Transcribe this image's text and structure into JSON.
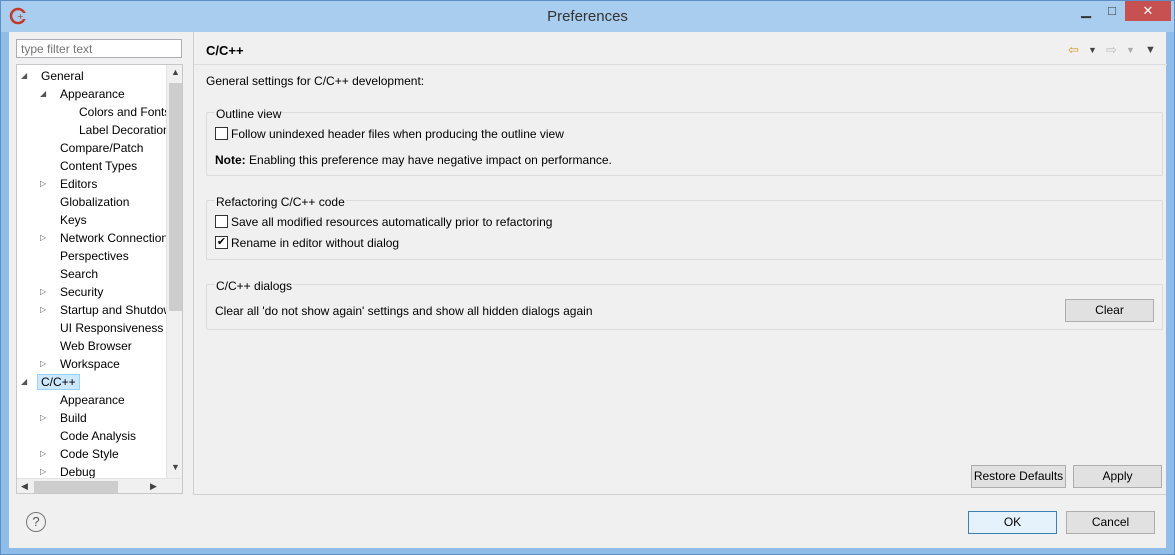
{
  "window": {
    "title": "Preferences"
  },
  "filter": {
    "placeholder": "type filter text"
  },
  "tree": {
    "items": [
      {
        "label": "General",
        "toggle": "◢"
      },
      {
        "label": "Appearance",
        "toggle": "◢"
      },
      {
        "label": "Colors and Fonts",
        "toggle": ""
      },
      {
        "label": "Label Decorations",
        "toggle": ""
      },
      {
        "label": "Compare/Patch",
        "toggle": ""
      },
      {
        "label": "Content Types",
        "toggle": ""
      },
      {
        "label": "Editors",
        "toggle": "▷"
      },
      {
        "label": "Globalization",
        "toggle": ""
      },
      {
        "label": "Keys",
        "toggle": ""
      },
      {
        "label": "Network Connections",
        "toggle": "▷"
      },
      {
        "label": "Perspectives",
        "toggle": ""
      },
      {
        "label": "Search",
        "toggle": ""
      },
      {
        "label": "Security",
        "toggle": "▷"
      },
      {
        "label": "Startup and Shutdown",
        "toggle": "▷"
      },
      {
        "label": "UI Responsiveness Monitoring",
        "toggle": ""
      },
      {
        "label": "Web Browser",
        "toggle": ""
      },
      {
        "label": "Workspace",
        "toggle": "▷"
      },
      {
        "label": "C/C++",
        "toggle": "◢"
      },
      {
        "label": "Appearance",
        "toggle": ""
      },
      {
        "label": "Build",
        "toggle": "▷"
      },
      {
        "label": "Code Analysis",
        "toggle": ""
      },
      {
        "label": "Code Style",
        "toggle": "▷"
      },
      {
        "label": "Debug",
        "toggle": "▷"
      }
    ]
  },
  "panel": {
    "title": "C/C++",
    "description": "General settings for C/C++ development:",
    "outline": {
      "label": "Outline view",
      "checkbox_label": "Follow unindexed header files when producing the outline view",
      "checked": false,
      "note_bold": "Note:",
      "note_text": "Enabling this preference may have negative impact on performance."
    },
    "refactoring": {
      "label": "Refactoring C/C++ code",
      "save_label": "Save all modified resources automatically prior to refactoring",
      "save_checked": false,
      "rename_label": "Rename in editor without dialog",
      "rename_checked": true
    },
    "dialogs": {
      "label": "C/C++ dialogs",
      "text": "Clear all 'do not show again' settings and show all hidden dialogs again",
      "clear_button": "Clear"
    }
  },
  "buttons": {
    "restore_defaults": "Restore Defaults",
    "apply": "Apply",
    "ok": "OK",
    "cancel": "Cancel",
    "help": "?"
  },
  "icons": {
    "back": "arrow-left-icon",
    "forward": "arrow-right-icon",
    "menu": "view-menu-icon",
    "checkmark": "✔"
  },
  "colors": {
    "title_bar": "#a9cdef",
    "close_button": "#c75050",
    "selection": "#cce8ff",
    "back_arrow": "#d39a2a"
  }
}
